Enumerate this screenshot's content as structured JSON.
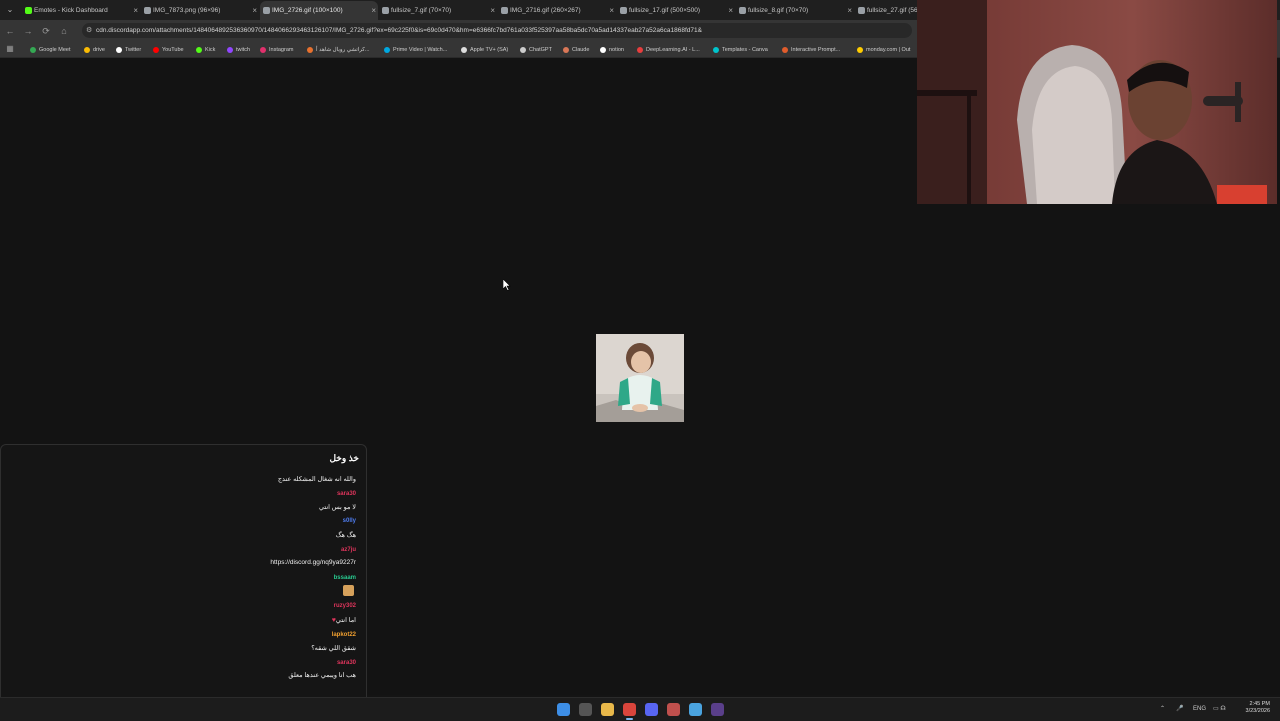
{
  "browser": {
    "tabs": [
      {
        "title": "Emotes - Kick Dashboard",
        "active": false,
        "favicon_color": "#53fc18"
      },
      {
        "title": "IMG_7873.png (96×96)",
        "active": false,
        "favicon_color": "#9aa0a6"
      },
      {
        "title": "IMG_2726.gif (100×100)",
        "active": true,
        "favicon_color": "#9aa0a6"
      },
      {
        "title": "fullsize_7.gif (70×70)",
        "active": false,
        "favicon_color": "#9aa0a6"
      },
      {
        "title": "IMG_2716.gif (260×267)",
        "active": false,
        "favicon_color": "#9aa0a6"
      },
      {
        "title": "fullsize_17.gif (500×500)",
        "active": false,
        "favicon_color": "#9aa0a6"
      },
      {
        "title": "fullsize_8.gif (70×70)",
        "active": false,
        "favicon_color": "#9aa0a6"
      },
      {
        "title": "fullsize_27.gif (56×",
        "active": false,
        "favicon_color": "#9aa0a6"
      }
    ],
    "tab_close_glyph": "×",
    "tab_menu_glyph": "⌄",
    "url": "cdn.discordapp.com/attachments/1484064892536360970/1484066293463126107/IMG_2726.gif?ex=69c225f0&is=69c0d470&hm=e6366fc7bd761a033f525397aa58ba5dc70a5ad14337eab27a52a6ca1868fd71&",
    "nav_icons": {
      "back": "←",
      "forward": "→",
      "reload": "⟳",
      "home": "⌂",
      "tune": "⚙"
    },
    "bookmarks": [
      {
        "label": "Google Meet",
        "color": "#34a853"
      },
      {
        "label": "drive",
        "color": "#fbbc04"
      },
      {
        "label": "Twitter",
        "color": "#ffffff"
      },
      {
        "label": "YouTube",
        "color": "#ff0000"
      },
      {
        "label": "Kick",
        "color": "#53fc18"
      },
      {
        "label": "twitch",
        "color": "#9146ff"
      },
      {
        "label": "Instagram",
        "color": "#e1306c"
      },
      {
        "label": "كراتشي رويال شاهد أ...",
        "color": "#e8712e"
      },
      {
        "label": "Prime Video | Watch...",
        "color": "#00a8e1"
      },
      {
        "label": "Apple TV+ (SA)",
        "color": "#dddddd"
      },
      {
        "label": "ChatGPT",
        "color": "#cccccc"
      },
      {
        "label": "Claude",
        "color": "#d97757"
      },
      {
        "label": "notion",
        "color": "#ffffff"
      },
      {
        "label": "DeepLearning.AI - L...",
        "color": "#e83e3e"
      },
      {
        "label": "Templates - Canva",
        "color": "#00c4cc"
      },
      {
        "label": "Interactive Prompt...",
        "color": "#e05c2c"
      },
      {
        "label": "monday.com | Out",
        "color": "#ffcc00"
      }
    ]
  },
  "chat": {
    "title": "خذ وخل",
    "messages": [
      {
        "username": "",
        "text": "والله انه شغال المشكله عندج",
        "color": "#ffffff"
      },
      {
        "username": "sara30",
        "text": "لا مو بس انتي",
        "color": "#e0355c"
      },
      {
        "username": "s0lly",
        "text": "هگ هگ",
        "color": "#4f7df0"
      },
      {
        "username": "az7ju",
        "text": "https://discord.gg/nq9ya9227r",
        "color": "#e0355c"
      },
      {
        "username": "bssaam",
        "text": "",
        "color": "#28c98f",
        "emote": true
      },
      {
        "username": "ruzy302",
        "text": "اما انتي",
        "color": "#e0355c",
        "heart": "♥"
      },
      {
        "username": "lapkot22",
        "text": "شقق اللي شقه؟",
        "color": "#f0a030"
      },
      {
        "username": "sara30",
        "text": "هب انا ويبمي عندها معلق",
        "color": "#e0355c"
      }
    ]
  },
  "taskbar": {
    "tray_lang": "ENG",
    "tray_up": "⌃",
    "tray_mic": "🎤",
    "tray_icons": "▭ ☊",
    "clock_time": "2:45 PM",
    "clock_date": "3/23/2026"
  }
}
